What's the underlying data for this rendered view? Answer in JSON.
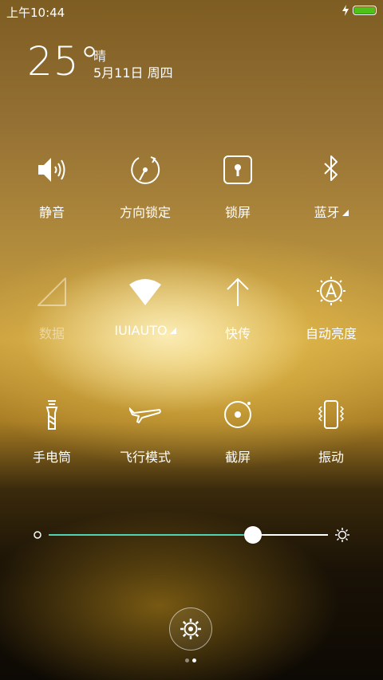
{
  "status_bar": {
    "time": "上午10:44",
    "battery_color": "#4fc21a",
    "charging_icon": "bolt-icon"
  },
  "weather": {
    "temperature": "25°",
    "condition": "晴",
    "date": "5月11日 周四"
  },
  "toggles": [
    {
      "label": "静音",
      "icon": "speaker-icon",
      "active": true
    },
    {
      "label": "方向锁定",
      "icon": "rotation-lock-icon",
      "active": true
    },
    {
      "label": "锁屏",
      "icon": "lock-screen-icon",
      "active": true
    },
    {
      "label": "蓝牙",
      "icon": "bluetooth-icon",
      "active": true,
      "has_submenu": true
    },
    {
      "label": "数据",
      "icon": "mobile-data-icon",
      "active": false
    },
    {
      "label": "IUIAUTO",
      "icon": "wifi-icon",
      "active": true,
      "has_submenu": true
    },
    {
      "label": "快传",
      "icon": "quick-transfer-icon",
      "active": true
    },
    {
      "label": "自动亮度",
      "icon": "auto-brightness-icon",
      "active": true
    },
    {
      "label": "手电筒",
      "icon": "flashlight-icon",
      "active": true
    },
    {
      "label": "飞行模式",
      "icon": "airplane-icon",
      "active": true
    },
    {
      "label": "截屏",
      "icon": "screenshot-icon",
      "active": true
    },
    {
      "label": "振动",
      "icon": "vibrate-icon",
      "active": true
    }
  ],
  "brightness": {
    "level": 0.73,
    "track_color": "#4ed3b4"
  },
  "pager": {
    "pages": 2,
    "current": 2
  }
}
